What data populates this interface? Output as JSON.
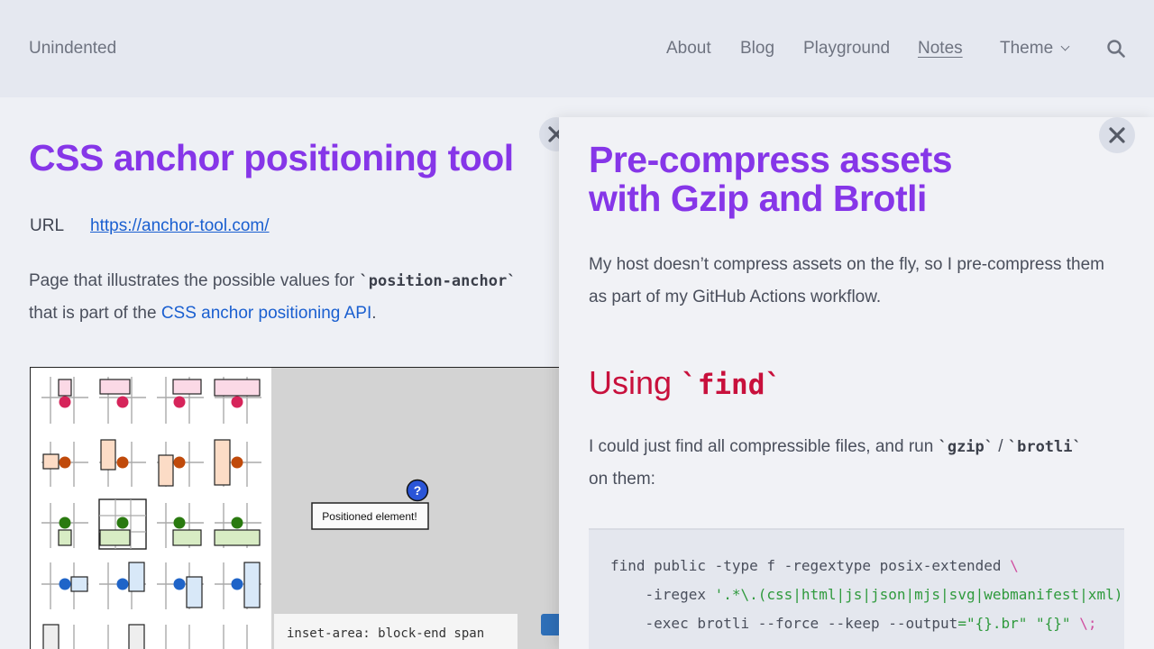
{
  "header": {
    "site_name": "Unindented",
    "nav": [
      "About",
      "Blog",
      "Playground",
      "Notes"
    ],
    "theme_label": "Theme"
  },
  "left_panel": {
    "title": "CSS anchor positioning tool",
    "url_label": "URL",
    "url_value": "https://anchor-tool.com/",
    "desc_before": "Page that illustrates the possible values for ",
    "desc_code": "`position-anchor`",
    "desc_middle": "that is part of the ",
    "desc_link": "CSS anchor positioning API",
    "desc_end": ".",
    "figure": {
      "positioned_label": "Positioned element!",
      "marker": "?",
      "inset_text": "inset-area: block-end span"
    }
  },
  "right_panel": {
    "title_line1": "Pre-compress assets",
    "title_line2": "with Gzip and Brotli",
    "intro": "My host doesn’t compress assets on the fly, so I pre-compress them as part of my GitHub Actions workflow.",
    "section_heading_prefix": "Using ",
    "section_heading_code": "`find`",
    "para_before": "I could just find all compressible files, and run ",
    "para_code1": "`gzip`",
    "para_sep": " / ",
    "para_code2": "`brotli`",
    "para_after": "on them:",
    "code": {
      "line1": "find public -type f -regextype posix-extended ",
      "line1_cont": "\\",
      "line2_a": "    -iregex ",
      "line2_str": "'.*\\.(css|html|js|json|mjs|svg|webmanifest|xml)",
      "line3_a": "    -exec brotli --force --keep --output",
      "line3_eq": "=",
      "line3_s1": "\"{}.br\"",
      "line3_s2": "\"{}\"",
      "line3_end": "\\;"
    }
  }
}
